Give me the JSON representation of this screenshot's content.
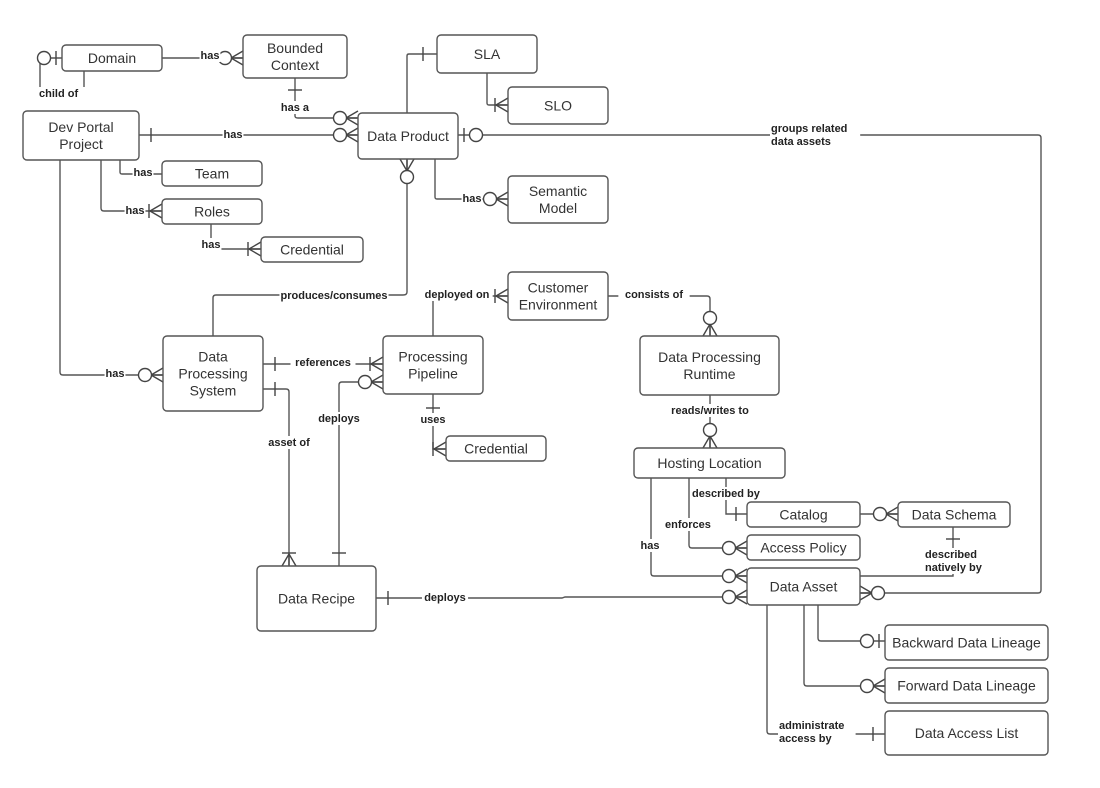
{
  "diagram": {
    "type": "entity-relationship",
    "entities": {
      "domain": "Domain",
      "bounded_context": [
        "Bounded",
        "Context"
      ],
      "dev_portal_project": [
        "Dev Portal",
        "Project"
      ],
      "sla": "SLA",
      "slo": "SLO",
      "data_product": "Data Product",
      "team": "Team",
      "roles": "Roles",
      "credential_roles": "Credential",
      "semantic_model": [
        "Semantic",
        "Model"
      ],
      "customer_environment": [
        "Customer",
        "Environment"
      ],
      "data_processing_system": [
        "Data",
        "Processing",
        "System"
      ],
      "processing_pipeline": [
        "Processing",
        "Pipeline"
      ],
      "data_processing_runtime": [
        "Data Processing",
        "Runtime"
      ],
      "credential_pipeline": "Credential",
      "hosting_location": "Hosting Location",
      "catalog": "Catalog",
      "data_schema": "Data Schema",
      "access_policy": "Access Policy",
      "data_recipe": "Data Recipe",
      "data_asset": "Data Asset",
      "backward_lineage": "Backward Data Lineage",
      "forward_lineage": "Forward Data Lineage",
      "data_access_list": "Data Access List"
    },
    "relationships": {
      "domain_child_of": [
        "child of"
      ],
      "domain_has_bc": [
        "has"
      ],
      "bc_has_a": [
        "has a"
      ],
      "devportal_has_dp": [
        "has"
      ],
      "dp_groups_assets": [
        "groups related",
        "data assets"
      ],
      "devportal_has_team": [
        "has"
      ],
      "devportal_has_roles": [
        "has"
      ],
      "roles_has_cred": [
        "has"
      ],
      "dp_has_semantic": [
        "has"
      ],
      "dps_produces_consumes": [
        "produces/consumes"
      ],
      "pipeline_deployed_on": [
        "deployed on"
      ],
      "env_consists_of": [
        "consists of"
      ],
      "devportal_has_dps": [
        "has"
      ],
      "dps_references": [
        "references"
      ],
      "recipe_deploys_pipeline": [
        "deploys"
      ],
      "pipeline_uses": [
        "uses"
      ],
      "runtime_reads_writes": [
        "reads/writes to"
      ],
      "recipe_asset_of": [
        "asset of"
      ],
      "hosting_described_by": [
        "described by"
      ],
      "hosting_enforces": [
        "enforces"
      ],
      "hosting_has": [
        "has"
      ],
      "schema_described_natively": [
        "described",
        "natively by"
      ],
      "recipe_deploys_asset": [
        "deploys"
      ],
      "asset_admin_access": [
        "administrate",
        "access by"
      ]
    }
  }
}
